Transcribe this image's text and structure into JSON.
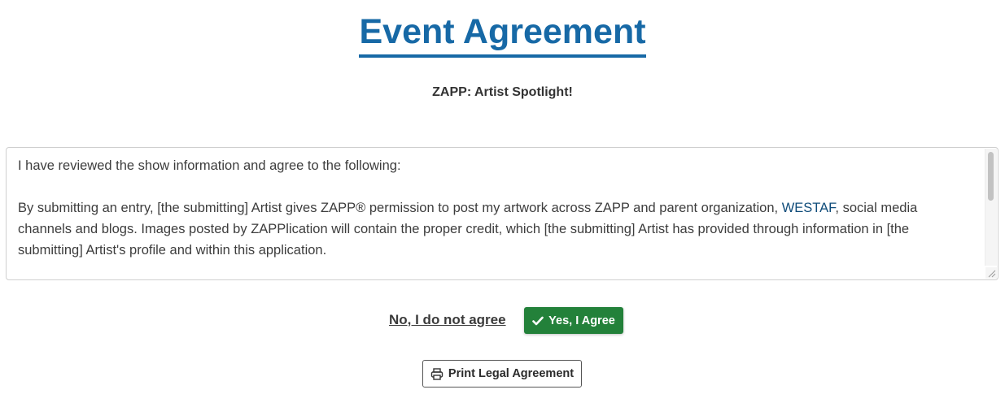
{
  "page": {
    "title": "Event Agreement",
    "subtitle": "ZAPP: Artist Spotlight!"
  },
  "agreement": {
    "intro": "I have reviewed the show information and agree to the following:",
    "body_before_link": "By submitting an entry, [the submitting] Artist gives ZAPP® permission to post my artwork across ZAPP and parent organization, ",
    "link_text": "WESTAF",
    "body_after_link": ", social media channels and blogs. Images posted by ZAPPlication will contain the proper credit, which [the submitting] Artist has provided through information in [the submitting] Artist's profile and within this application."
  },
  "actions": {
    "decline_label": "No, I do not agree",
    "agree_label": "Yes, I Agree",
    "print_label": "Print Legal Agreement"
  },
  "icons": {
    "agree": "check-icon",
    "print": "printer-icon"
  },
  "colors": {
    "title": "#1769a6",
    "agree_button": "#23813a",
    "link": "#0f4c7a"
  }
}
